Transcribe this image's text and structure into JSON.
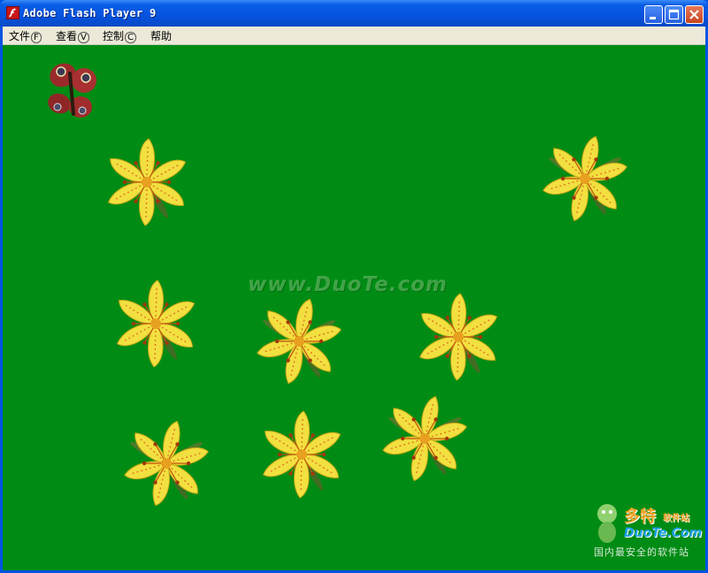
{
  "window": {
    "title": "Adobe Flash Player 9"
  },
  "menubar": {
    "items": [
      {
        "label": "文件",
        "key": "F"
      },
      {
        "label": "查看",
        "key": "V"
      },
      {
        "label": "控制",
        "key": "C"
      },
      {
        "label": "帮助",
        "key": ""
      }
    ]
  },
  "stage": {
    "background_color": "#008c14",
    "watermark": "www.DuoTe.com",
    "flower_color": "#f2e040"
  },
  "logo": {
    "name": "多特",
    "name_suffix": "软件站",
    "site": "DuoTe.Com",
    "slogan": "国内最安全的软件站"
  }
}
